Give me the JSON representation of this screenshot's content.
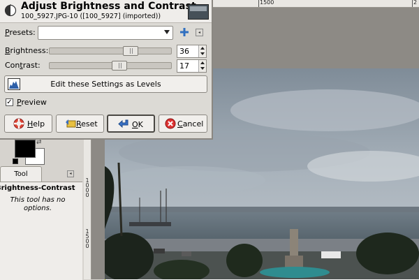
{
  "ruler": {
    "top_labels": [
      "1500",
      "2"
    ],
    "left_labels": [
      "1000",
      "1500"
    ]
  },
  "dialog": {
    "title": "Adjust Brightness and Contrast",
    "subtitle": "100_5927.JPG-10 ([100_5927] (imported))",
    "presets": {
      "label_prefix": "",
      "label_mnemonic": "P",
      "label_rest": "resets:",
      "value": ""
    },
    "brightness": {
      "label_mnemonic": "B",
      "label_rest": "rightness:",
      "value": "36",
      "fraction": 0.68
    },
    "contrast": {
      "label_prefix": "Con",
      "label_mnemonic": "t",
      "label_rest": "rast:",
      "value": "17",
      "fraction": 0.58
    },
    "levels_button": "Edit these Settings as Levels",
    "preview": {
      "mnemonic": "P",
      "rest": "review",
      "checked": true,
      "mark": "✓"
    },
    "buttons": {
      "help": {
        "mnemonic": "H",
        "rest": "elp"
      },
      "reset": {
        "mnemonic": "R",
        "rest": "eset"
      },
      "ok": {
        "mnemonic": "O",
        "rest": "K"
      },
      "cancel": {
        "mnemonic": "C",
        "rest": "ancel"
      }
    }
  },
  "dock": {
    "tab_label": "Tool Options",
    "tool_name": "Brightness-Contrast",
    "no_options": "This tool has no options."
  },
  "colors": {
    "dialog_bg": "#dcdad5",
    "canvas_bg": "#8d8a85",
    "selection_dash": "#c8c800"
  }
}
